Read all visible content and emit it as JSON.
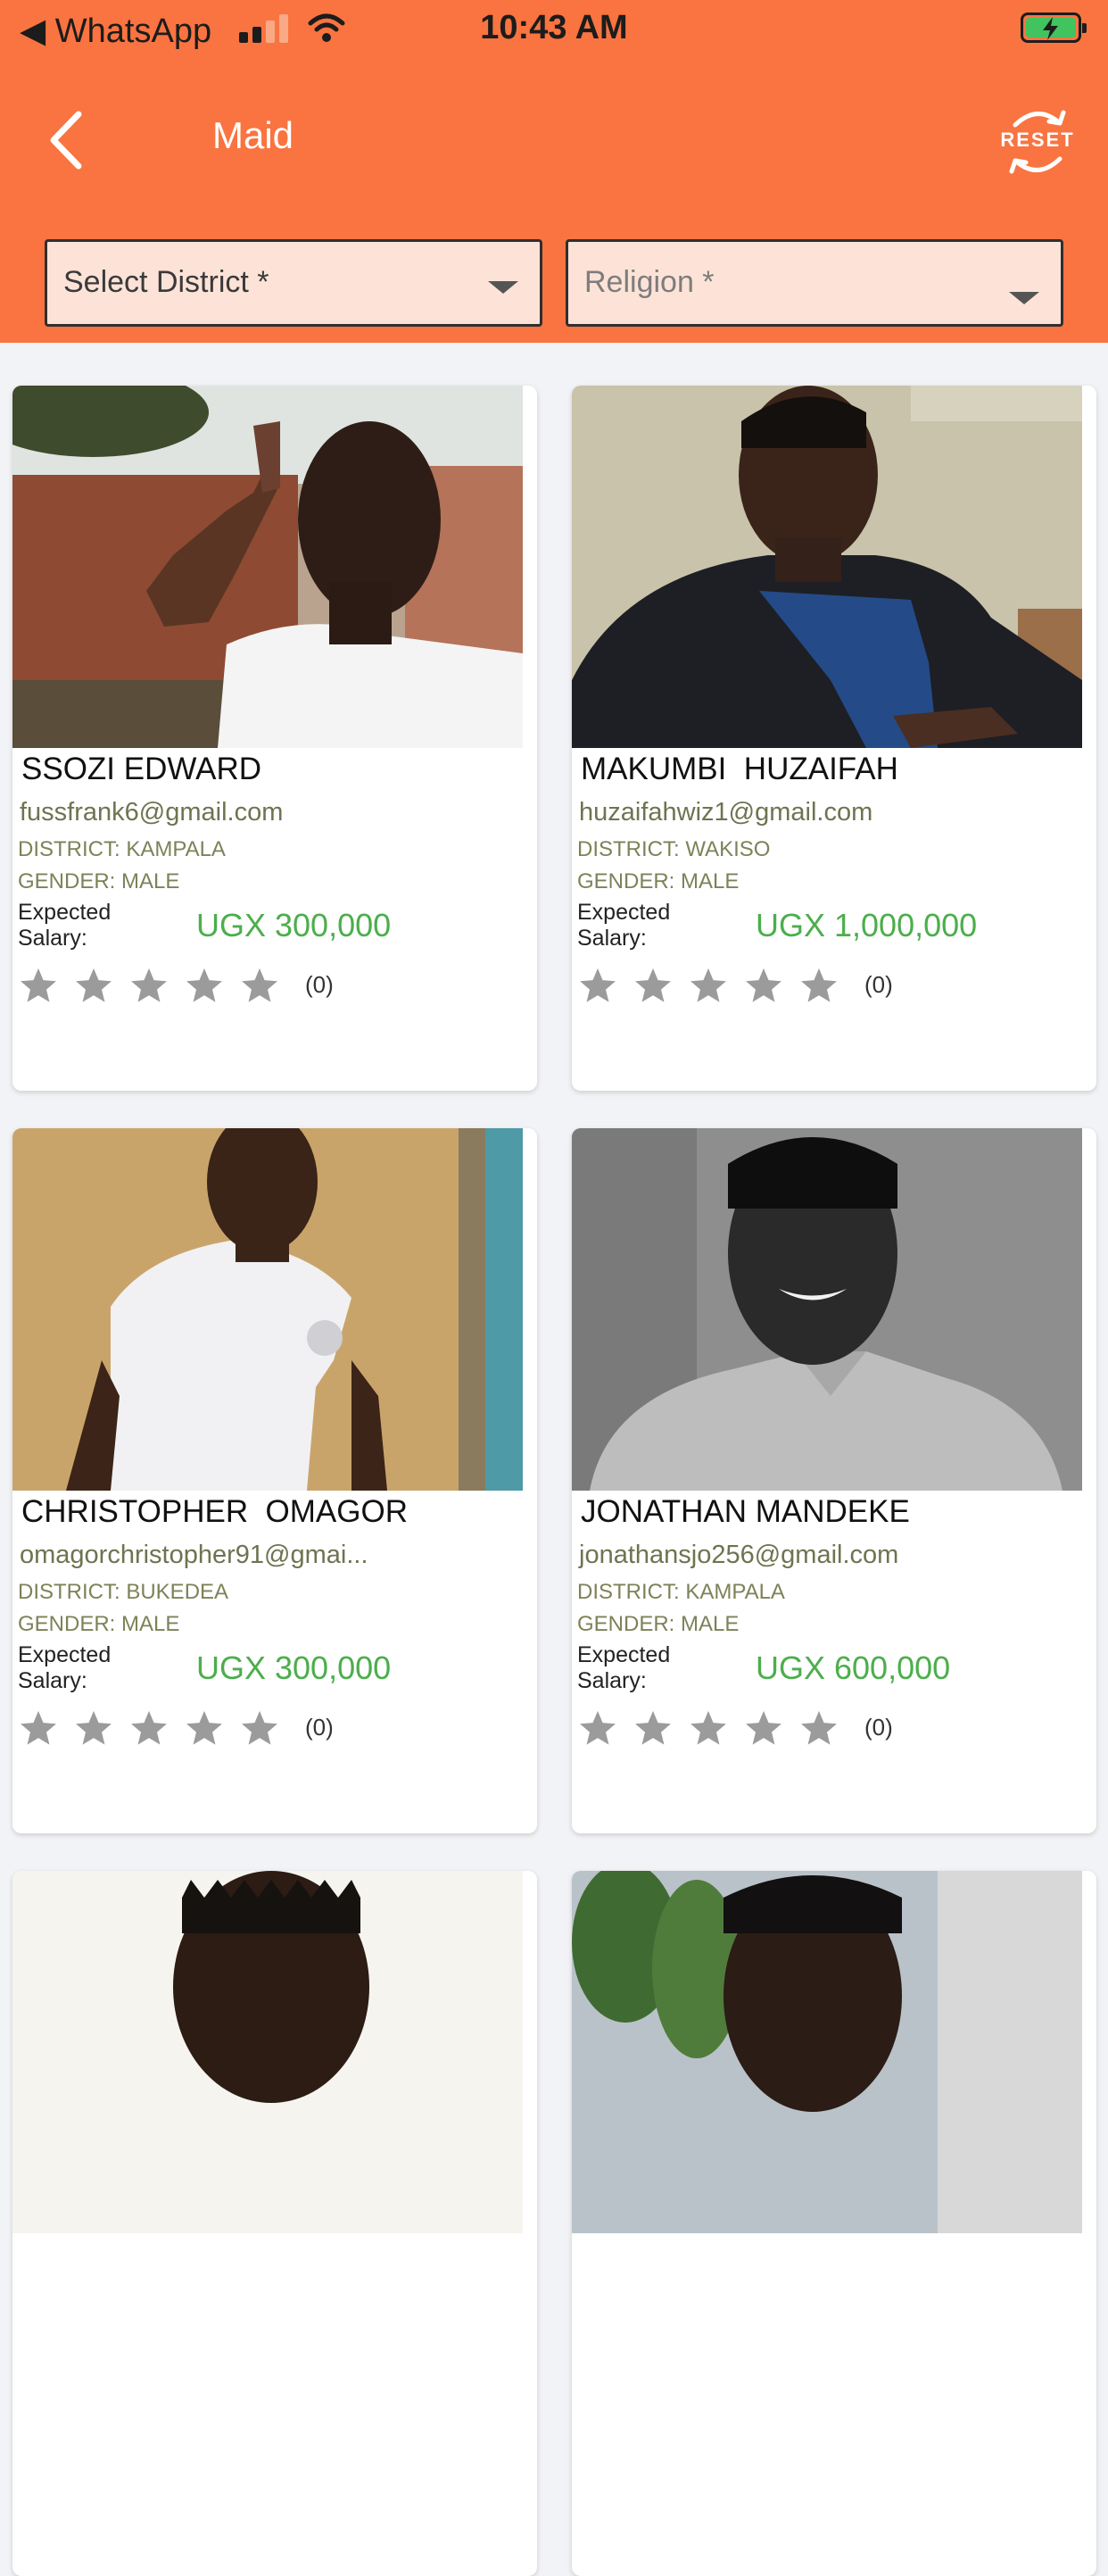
{
  "status_bar": {
    "back_app": "◀ WhatsApp",
    "time": "10:43 AM"
  },
  "header": {
    "title": "Maid",
    "reset_label": "RESET",
    "district_select": {
      "value": "Select District *"
    },
    "religion_select": {
      "value": "Religion *"
    }
  },
  "colors": {
    "header_bg": "#f97440",
    "salary_green": "#4cae4c",
    "select_bg": "#fde3d7"
  },
  "workers": [
    {
      "name": "SSOZI EDWARD",
      "email": "fussfrank6@gmail.com",
      "district": "DISTRICT: KAMPALA",
      "gender": "GENDER: MALE",
      "salary_label": "Expected Salary:",
      "salary": "UGX 300,000",
      "rating_stars": 0,
      "rating_count": "(0)"
    },
    {
      "name": "MAKUMBI  HUZAIFAH",
      "email": "huzaifahwiz1@gmail.com",
      "district": "DISTRICT: WAKISO",
      "gender": "GENDER: MALE",
      "salary_label": "Expected Salary:",
      "salary": "UGX 1,000,000",
      "rating_stars": 0,
      "rating_count": "(0)"
    },
    {
      "name": "CHRISTOPHER  OMAGOR",
      "email": "omagorchristopher91@gmai...",
      "district": "DISTRICT: BUKEDEA",
      "gender": "GENDER: MALE",
      "salary_label": "Expected Salary:",
      "salary": "UGX 300,000",
      "rating_stars": 0,
      "rating_count": "(0)"
    },
    {
      "name": "JONATHAN MANDEKE",
      "email": "jonathansjo256@gmail.com",
      "district": "DISTRICT: KAMPALA",
      "gender": "GENDER: MALE",
      "salary_label": "Expected Salary:",
      "salary": "UGX 600,000",
      "rating_stars": 0,
      "rating_count": "(0)"
    }
  ]
}
